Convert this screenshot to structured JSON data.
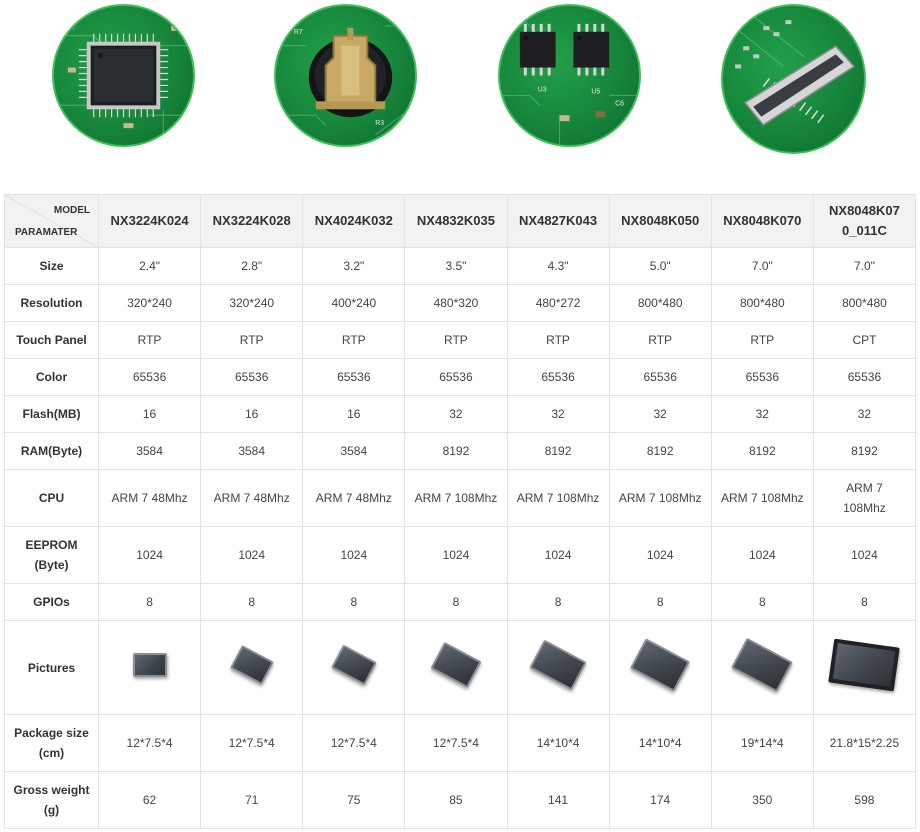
{
  "features": [
    {
      "icon": "microcontroller-chip-icon"
    },
    {
      "icon": "coin-battery-holder-icon"
    },
    {
      "icon": "memory-chips-icon"
    },
    {
      "icon": "fpc-connector-icon"
    }
  ],
  "table": {
    "corner_model": "MODEL",
    "corner_param": "PARAMATER",
    "models": [
      "NX3224K024",
      "NX3224K028",
      "NX4024K032",
      "NX4832K035",
      "NX4827K043",
      "NX8048K050",
      "NX8048K070",
      "NX8048K07\n0_011C"
    ],
    "rows": [
      {
        "label": "Size",
        "values": [
          "2.4\"",
          "2.8\"",
          "3.2\"",
          "3.5\"",
          "4.3\"",
          "5.0\"",
          "7.0\"",
          "7.0\""
        ]
      },
      {
        "label": "Resolution",
        "values": [
          "320*240",
          "320*240",
          "400*240",
          "480*320",
          "480*272",
          "800*480",
          "800*480",
          "800*480"
        ]
      },
      {
        "label": "Touch Panel",
        "values": [
          "RTP",
          "RTP",
          "RTP",
          "RTP",
          "RTP",
          "RTP",
          "RTP",
          "CPT"
        ]
      },
      {
        "label": "Color",
        "values": [
          "65536",
          "65536",
          "65536",
          "65536",
          "65536",
          "65536",
          "65536",
          "65536"
        ]
      },
      {
        "label": "Flash(MB)",
        "values": [
          "16",
          "16",
          "16",
          "32",
          "32",
          "32",
          "32",
          "32"
        ]
      },
      {
        "label": "RAM(Byte)",
        "values": [
          "3584",
          "3584",
          "3584",
          "8192",
          "8192",
          "8192",
          "8192",
          "8192"
        ]
      },
      {
        "label": "CPU",
        "values": [
          "ARM 7 48Mhz",
          "ARM 7 48Mhz",
          "ARM 7 48Mhz",
          "ARM 7 108Mhz",
          "ARM 7 108Mhz",
          "ARM 7 108Mhz",
          "ARM 7 108Mhz",
          "ARM 7\n108Mhz"
        ]
      },
      {
        "label": "EEPROM\n(Byte)",
        "values": [
          "1024",
          "1024",
          "1024",
          "1024",
          "1024",
          "1024",
          "1024",
          "1024"
        ]
      },
      {
        "label": "GPIOs",
        "values": [
          "8",
          "8",
          "8",
          "8",
          "8",
          "8",
          "8",
          "8"
        ]
      },
      {
        "label": "Pictures",
        "values": [
          "lcd-module-icon",
          "lcd-module-icon",
          "lcd-module-icon",
          "lcd-module-icon",
          "lcd-module-icon",
          "lcd-module-icon",
          "lcd-module-icon",
          "lcd-module-bezel-icon"
        ]
      },
      {
        "label": "Package size\n(cm)",
        "values": [
          "12*7.5*4",
          "12*7.5*4",
          "12*7.5*4",
          "12*7.5*4",
          "14*10*4",
          "14*10*4",
          "19*14*4",
          "21.8*15*2.25"
        ]
      },
      {
        "label": "Gross weight\n(g)",
        "values": [
          "62",
          "71",
          "75",
          "85",
          "141",
          "174",
          "350",
          "598"
        ]
      }
    ]
  },
  "colors": {
    "pcb_green": "#1a8f40",
    "header_bg": "#f2f2f2",
    "border": "#e3e3e3"
  }
}
